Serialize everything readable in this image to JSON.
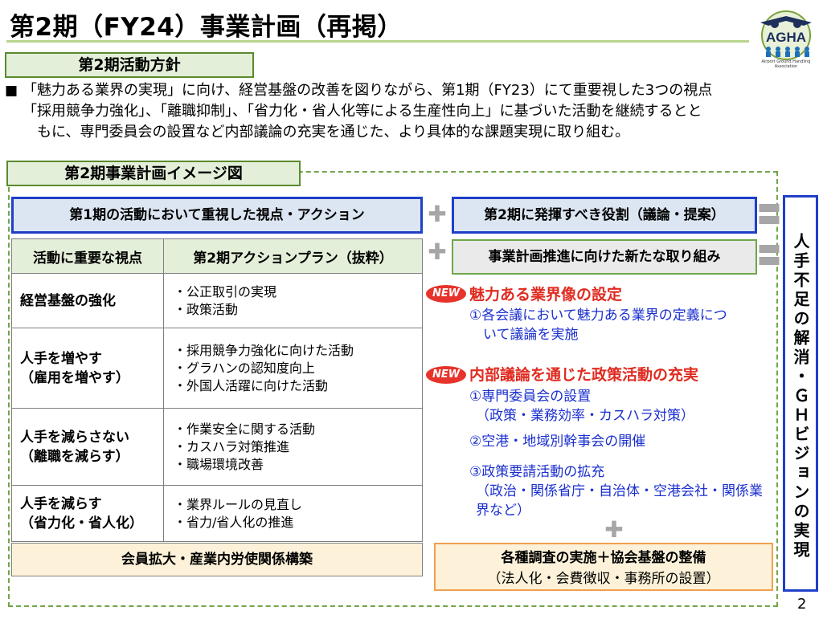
{
  "header": {
    "title": "第2期（FY24）事業計画（再掲）",
    "logo_text": "AGHA",
    "logo_caption": "Airport Ground Handling Association"
  },
  "policy": {
    "tag": "第2期活動方針",
    "bullet": "■",
    "lines": [
      "「魅力ある業界の実現」に向け、経営基盤の改善を図りながら、第1期（FY23）にて重要視した3つの視点",
      "「採用競争力強化」、「離職抑制」、「省力化・省人化等による生産性向上」に基づいた活動を継続するとと",
      "もに、専門委員会の設置など内部議論の充実を通じた、より具体的な課題実現に取り組む。"
    ]
  },
  "plan": {
    "tag": "第2期事業計画イメージ図",
    "left_header": "第1期の活動において重視した視点・アクション",
    "right_box1": "第2期に発揮すべき役割（議論・提案）",
    "right_box2": "事業計画推進に向けた新たな取り組み",
    "table": {
      "col1": "活動に重要な視点",
      "col2": "第2期アクションプラン（抜粋）",
      "rows": [
        {
          "head": [
            "経営基盤の強化"
          ],
          "actions": [
            "・公正取引の実現",
            "・政策活動"
          ]
        },
        {
          "head": [
            "人手を増やす",
            "（雇用を増やす）"
          ],
          "actions": [
            "・採用競争力強化に向けた活動",
            "・グラハンの認知度向上",
            "・外国人活躍に向けた活動"
          ]
        },
        {
          "head": [
            "人手を減らさない",
            "（離職を減らす）"
          ],
          "actions": [
            "・作業安全に関する活動",
            "・カスハラ対策推進",
            "・職場環境改善"
          ]
        },
        {
          "head": [
            "人手を減らす",
            "（省力化・省人化）"
          ],
          "actions": [
            "・業界ルールの見直し",
            "・省力/省人化の推進"
          ]
        }
      ],
      "footer": "会員拡大・産業内労使関係構築"
    },
    "new_badge": "NEW",
    "initiative1": {
      "title": "魅力ある業界像の設定",
      "lines": [
        "①各会議において魅力ある業界の定義につ",
        "　いて議論を実施"
      ]
    },
    "initiative2": {
      "title": "内部議論を通じた政策活動の充実",
      "items": [
        [
          "①専門委員会の設置",
          "（政策・業務効率・カスハラ対策）"
        ],
        [
          "②空港・地域別幹事会の開催"
        ],
        [
          "③政策要請活動の拡充",
          "（政治・関係省庁・自治体・空港会社・関係業",
          "界など）"
        ]
      ]
    },
    "foundation": {
      "line1": "各種調査の実施＋協会基盤の整備",
      "line2": "（法人化・会費徴収・事務所の設置）"
    },
    "goal": "人手不足の解消・ＧＨビジョンの実現"
  },
  "page_number": "2",
  "colors": {
    "blue": "#1f3fc8",
    "red": "#e02b20",
    "green": "#6fa64a",
    "orange": "#f0a050"
  }
}
